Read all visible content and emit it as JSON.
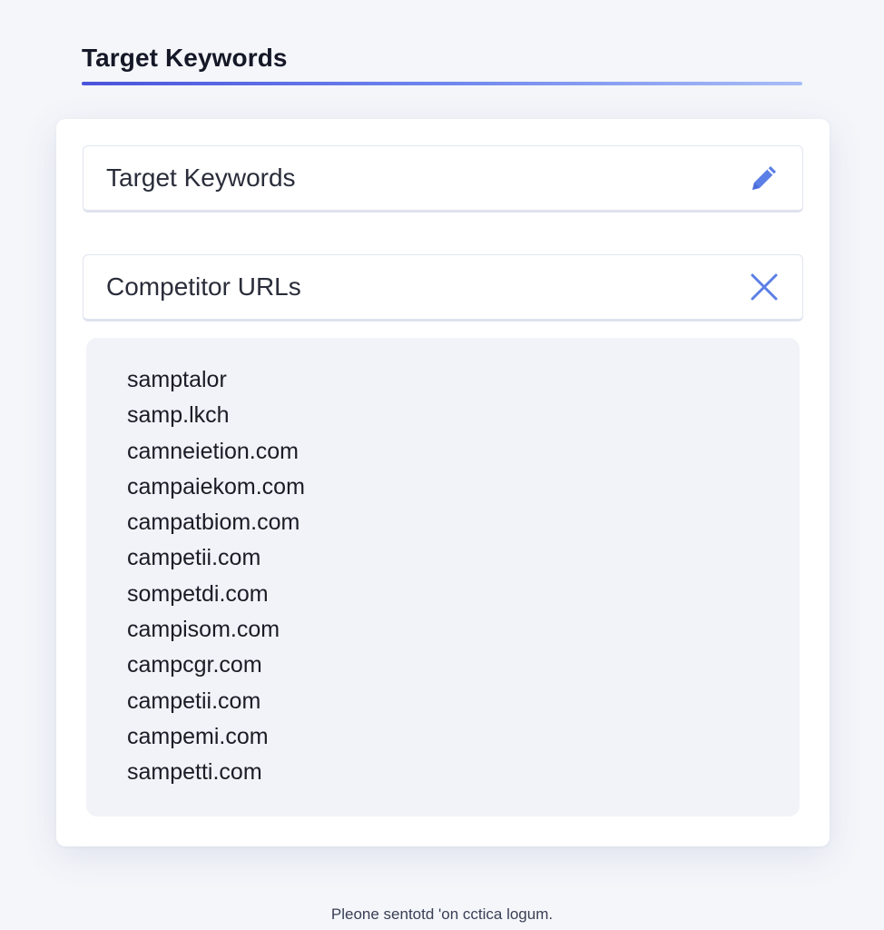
{
  "page": {
    "title": "Target Keywords"
  },
  "fields": {
    "keywords": {
      "label": "Target Keywords",
      "action_icon": "pencil-icon"
    },
    "competitors": {
      "label": "Competitor URLs",
      "action_icon": "close-icon"
    }
  },
  "competitor_urls": [
    "samptalor",
    "samp.lkch",
    "camneietion.com",
    "campaiekom.com",
    "campatbiom.com",
    "campetii.com",
    "sompetdi.com",
    "campisom.com",
    "campcgr.com",
    "campetii.com",
    "campemi.com",
    "sampetti.com"
  ],
  "footer": {
    "note": "Pleone sentotd 'on cctica logum."
  },
  "colors": {
    "accent": "#4a54dc",
    "icon": "#5b7fe6",
    "background": "#f4f6fa",
    "panel": "#f1f3f8"
  }
}
